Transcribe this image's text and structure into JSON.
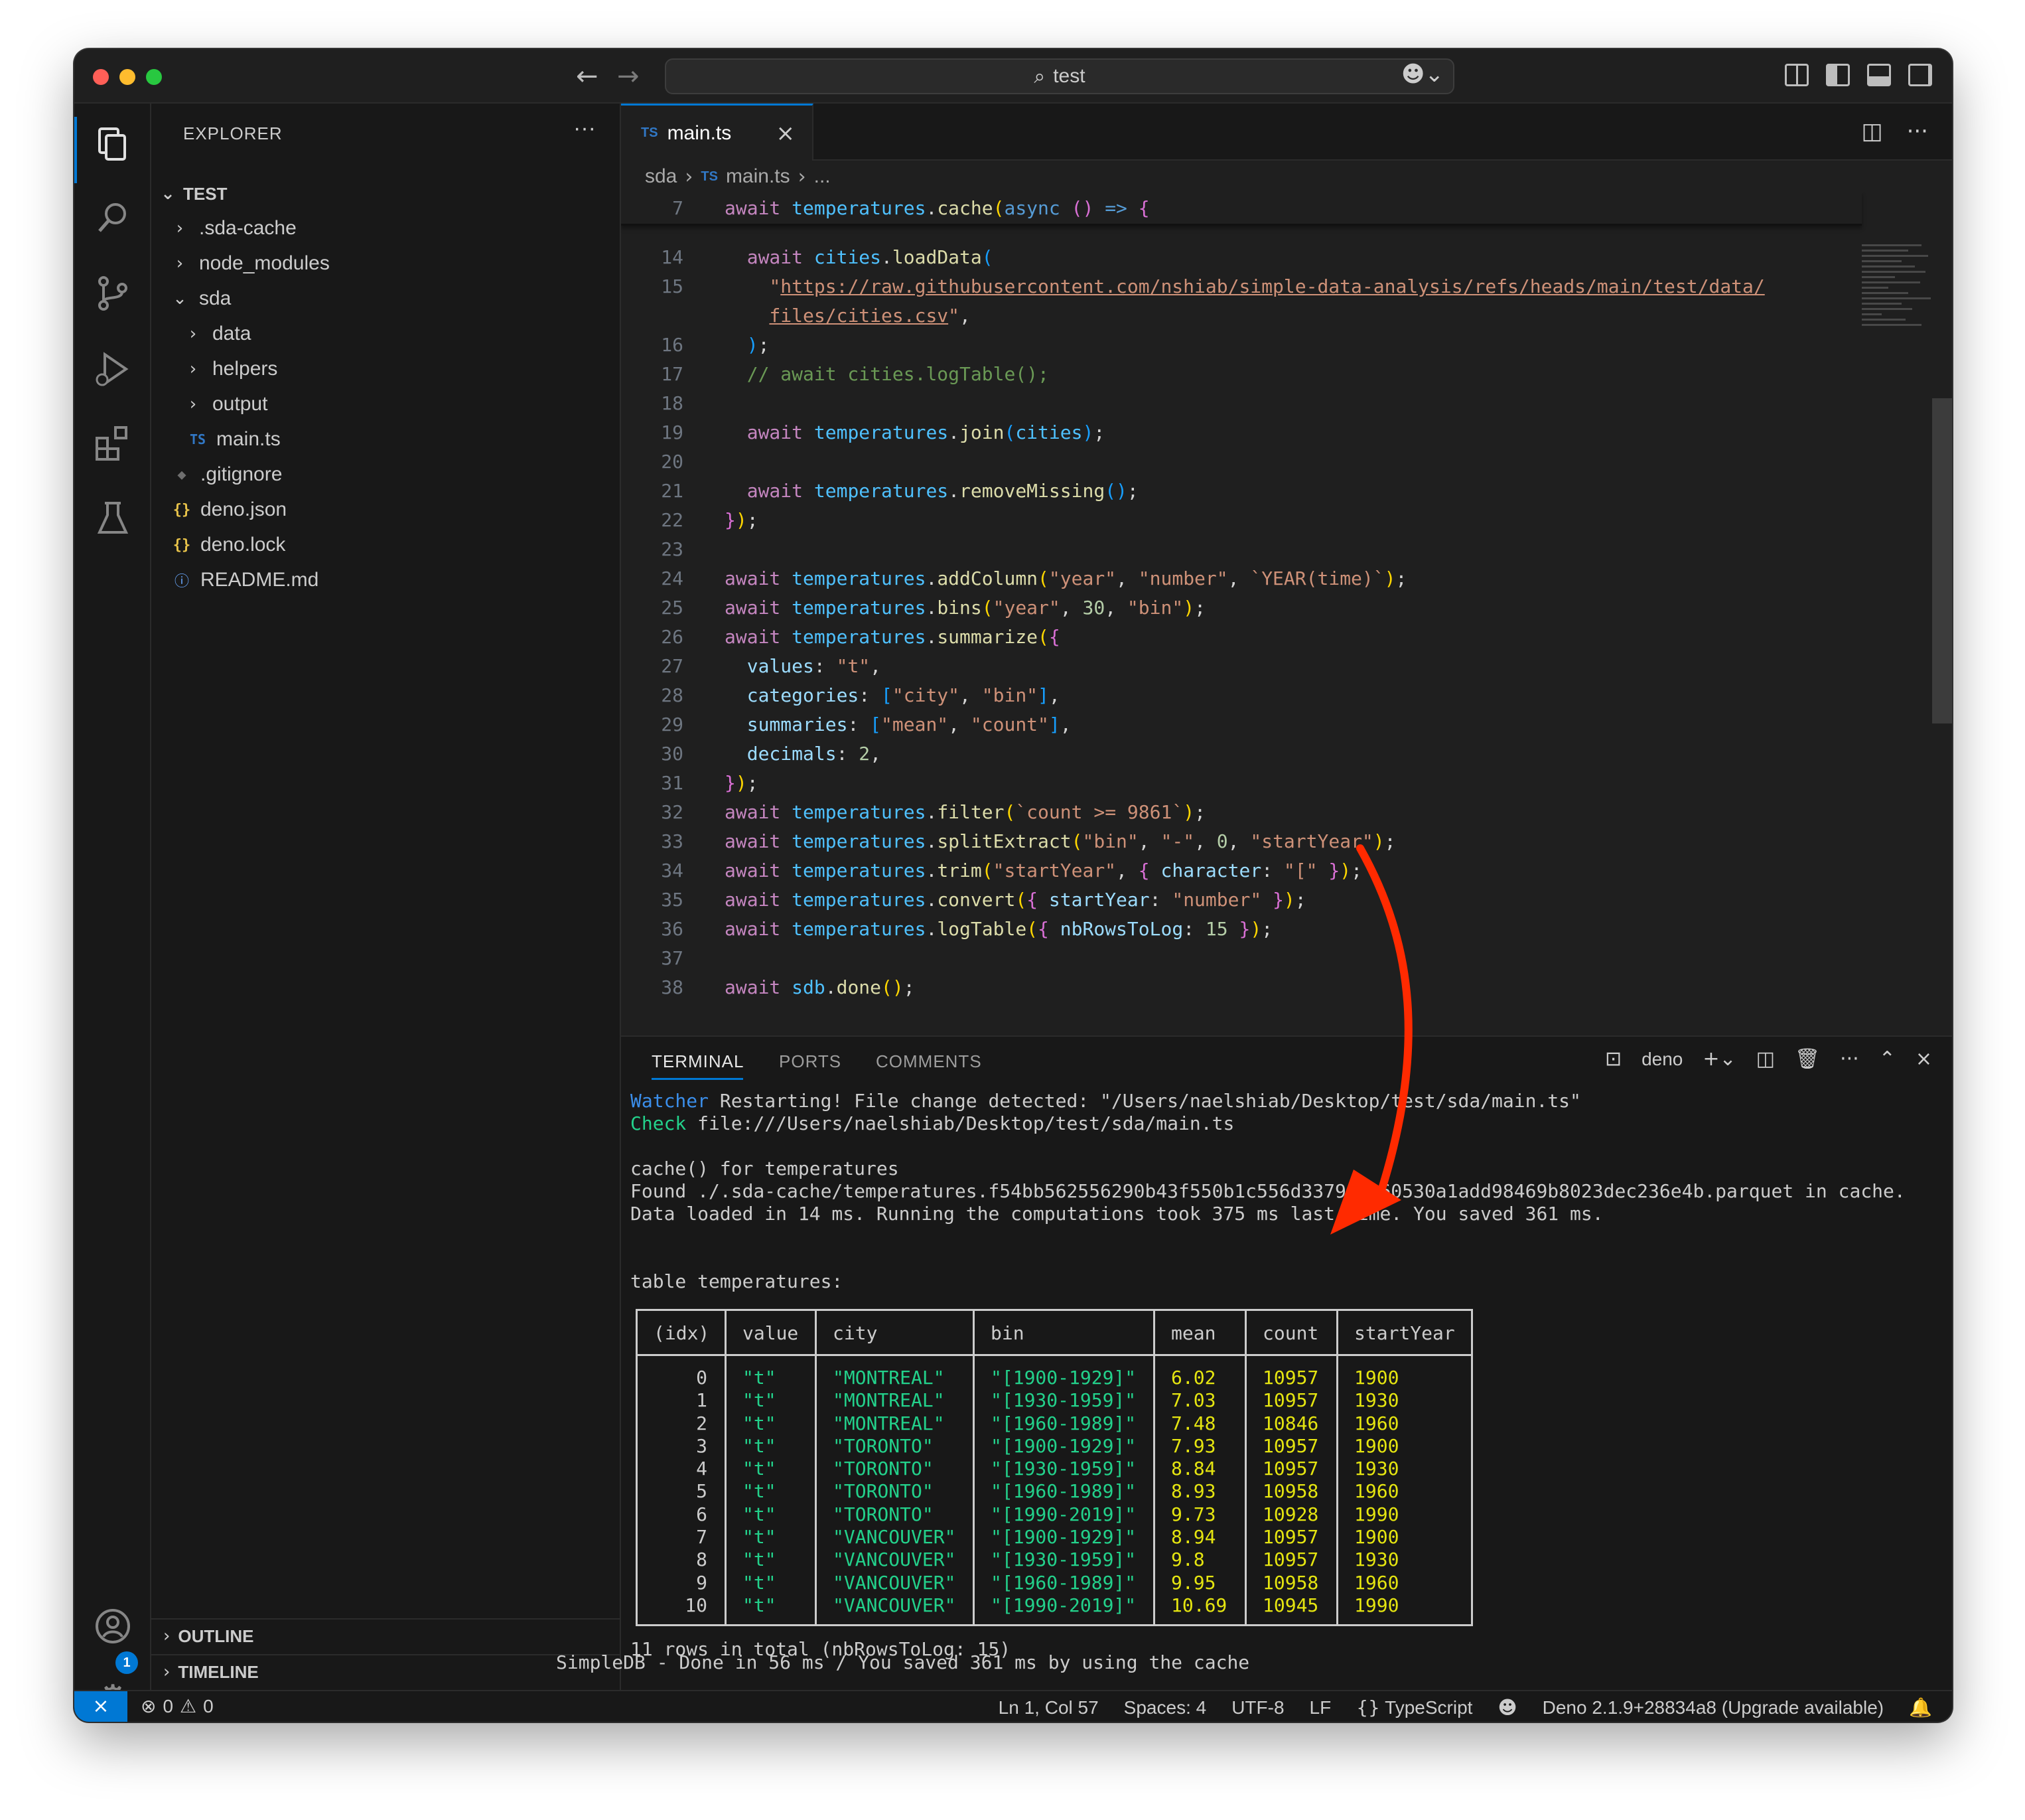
{
  "titlebar": {
    "search_text": "test",
    "back": "←",
    "forward": "→"
  },
  "sidebar": {
    "header": "EXPLORER",
    "more": "···",
    "root": "TEST",
    "items": [
      {
        "label": ".sda-cache",
        "type": "folder"
      },
      {
        "label": "node_modules",
        "type": "folder"
      },
      {
        "label": "sda",
        "type": "folder-open"
      },
      {
        "label": "data",
        "type": "folder"
      },
      {
        "label": "helpers",
        "type": "folder"
      },
      {
        "label": "output",
        "type": "folder"
      },
      {
        "label": "main.ts",
        "type": "ts"
      },
      {
        "label": ".gitignore",
        "type": "git"
      },
      {
        "label": "deno.json",
        "type": "json"
      },
      {
        "label": "deno.lock",
        "type": "json"
      },
      {
        "label": "README.md",
        "type": "info"
      }
    ],
    "outline": "OUTLINE",
    "timeline": "TIMELINE"
  },
  "editor": {
    "tab_label": "main.ts",
    "tab_icon": "TS",
    "breadcrumb": {
      "folder": "sda",
      "file": "main.ts",
      "tail": "..."
    }
  },
  "code": {
    "sticky": {
      "num": "7",
      "text": "await temperatures.cache(async () => {"
    },
    "lines": [
      {
        "num": "14"
      },
      {
        "num": "15"
      },
      {
        "num": ""
      },
      {
        "num": "16"
      },
      {
        "num": "17"
      },
      {
        "num": "18"
      },
      {
        "num": "19"
      },
      {
        "num": "20"
      },
      {
        "num": "21"
      },
      {
        "num": "22"
      },
      {
        "num": "23"
      },
      {
        "num": "24"
      },
      {
        "num": "25"
      },
      {
        "num": "26"
      },
      {
        "num": "27"
      },
      {
        "num": "28"
      },
      {
        "num": "29"
      },
      {
        "num": "30"
      },
      {
        "num": "31"
      },
      {
        "num": "32"
      },
      {
        "num": "33"
      },
      {
        "num": "34"
      },
      {
        "num": "35"
      },
      {
        "num": "36"
      },
      {
        "num": "37"
      },
      {
        "num": "38"
      }
    ]
  },
  "panel": {
    "tabs": [
      "TERMINAL",
      "PORTS",
      "COMMENTS"
    ],
    "terminal_name": "deno",
    "output": {
      "watcher_label": "Watcher",
      "watcher_text": " Restarting! File change detected: \"/Users/naelshiab/Desktop/test/sda/main.ts\"",
      "check_label": "Check",
      "check_text": " file:///Users/naelshiab/Desktop/test/sda/main.ts",
      "cache_line": "cache() for temperatures",
      "found_line": "Found ./.sda-cache/temperatures.f54bb562556290b43f550b1c556d3379d8860530a1add98469b8023dec236e4b.parquet in cache.",
      "loaded_line": "Data loaded in 14 ms. Running the computations took 375 ms last time. You saved 361 ms.",
      "table_title": "table temperatures:",
      "rows_total": "11 rows in total (nbRowsToLog: 15)",
      "done_line": "SimpleDB - Done in 56 ms / You saved 361 ms by using the cache"
    },
    "table": {
      "columns": [
        "(idx)",
        "value",
        "city",
        "bin",
        "mean",
        "count",
        "startYear"
      ],
      "rows": [
        [
          "0",
          "\"t\"",
          "\"MONTREAL\"",
          "\"[1900-1929]\"",
          "6.02",
          "10957",
          "1900"
        ],
        [
          "1",
          "\"t\"",
          "\"MONTREAL\"",
          "\"[1930-1959]\"",
          "7.03",
          "10957",
          "1930"
        ],
        [
          "2",
          "\"t\"",
          "\"MONTREAL\"",
          "\"[1960-1989]\"",
          "7.48",
          "10846",
          "1960"
        ],
        [
          "3",
          "\"t\"",
          "\"TORONTO\"",
          "\"[1900-1929]\"",
          "7.93",
          "10957",
          "1900"
        ],
        [
          "4",
          "\"t\"",
          "\"TORONTO\"",
          "\"[1930-1959]\"",
          "8.84",
          "10957",
          "1930"
        ],
        [
          "5",
          "\"t\"",
          "\"TORONTO\"",
          "\"[1960-1989]\"",
          "8.93",
          "10958",
          "1960"
        ],
        [
          "6",
          "\"t\"",
          "\"TORONTO\"",
          "\"[1990-2019]\"",
          "9.73",
          "10928",
          "1990"
        ],
        [
          "7",
          "\"t\"",
          "\"VANCOUVER\"",
          "\"[1900-1929]\"",
          "8.94",
          "10957",
          "1900"
        ],
        [
          "8",
          "\"t\"",
          "\"VANCOUVER\"",
          "\"[1930-1959]\"",
          "9.8",
          "10957",
          "1930"
        ],
        [
          "9",
          "\"t\"",
          "\"VANCOUVER\"",
          "\"[1960-1989]\"",
          "9.95",
          "10958",
          "1960"
        ],
        [
          "10",
          "\"t\"",
          "\"VANCOUVER\"",
          "\"[1990-2019]\"",
          "10.69",
          "10945",
          "1990"
        ]
      ]
    }
  },
  "statusbar": {
    "errors": "0",
    "warnings": "0",
    "position": "Ln 1, Col 57",
    "spaces": "Spaces: 4",
    "encoding": "UTF-8",
    "eol": "LF",
    "language": "TypeScript",
    "deno": "Deno 2.1.9+28834a8 (Upgrade available)"
  },
  "accounts_badge": "1",
  "colors": {
    "accent": "#0078d4",
    "annotation_arrow": "#ff2a00"
  }
}
